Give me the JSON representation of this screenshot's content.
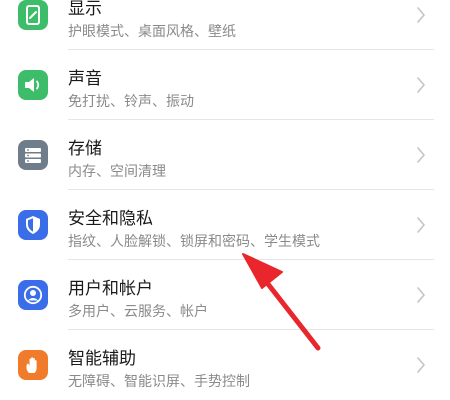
{
  "settings": {
    "items": [
      {
        "title": "显示",
        "subtitle": "护眼模式、桌面风格、壁纸",
        "icon": "display-icon",
        "color": "#3dbd6a"
      },
      {
        "title": "声音",
        "subtitle": "免打扰、铃声、振动",
        "icon": "speaker-icon",
        "color": "#3dbd6a"
      },
      {
        "title": "存储",
        "subtitle": "内存、空间清理",
        "icon": "storage-icon",
        "color": "#6f7c8a"
      },
      {
        "title": "安全和隐私",
        "subtitle": "指纹、人脸解锁、锁屏和密码、学生模式",
        "icon": "shield-icon",
        "color": "#3a6ee8"
      },
      {
        "title": "用户和帐户",
        "subtitle": "多用户、云服务、帐户",
        "icon": "user-icon",
        "color": "#3a6ee8"
      },
      {
        "title": "智能辅助",
        "subtitle": "无障碍、智能识屏、手势控制",
        "icon": "hand-icon",
        "color": "#f07b2a"
      }
    ]
  },
  "annotation": {
    "icon": "red-arrow-icon",
    "color": "#e8262b"
  }
}
